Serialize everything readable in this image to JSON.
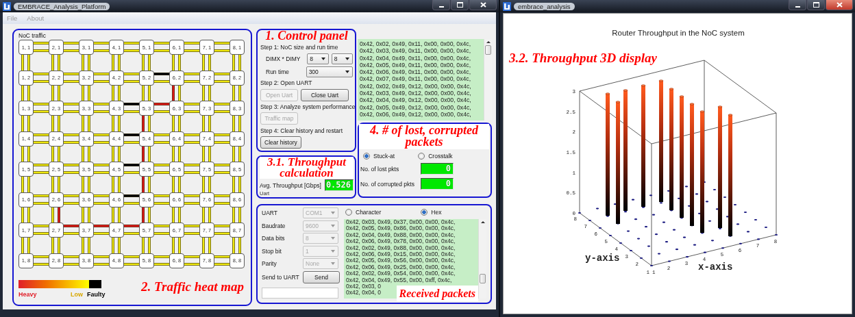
{
  "main_window": {
    "title": "EMBRACE_Analysis_Platform",
    "active": false,
    "menu": [
      "File",
      "About"
    ]
  },
  "heat_map": {
    "title": "NoC traffic",
    "annotation": "2. Traffic heat map",
    "routers": [
      [
        "1, 1",
        "2, 1",
        "3, 1",
        "4, 1",
        "5, 1",
        "6, 1",
        "7, 1",
        "8, 1"
      ],
      [
        "1, 2",
        "2, 2",
        "3, 2",
        "4, 2",
        "5, 2",
        "6, 2",
        "7, 2",
        "8, 2"
      ],
      [
        "1, 3",
        "2, 3",
        "3, 3",
        "4, 3",
        "5, 3",
        "6, 3",
        "7, 3",
        "8, 3"
      ],
      [
        "1, 4",
        "2, 4",
        "3, 4",
        "4, 4",
        "5, 4",
        "6, 4",
        "7, 4",
        "8, 4"
      ],
      [
        "1, 5",
        "2, 5",
        "3, 5",
        "4, 5",
        "5, 5",
        "6, 5",
        "7, 5",
        "8, 5"
      ],
      [
        "1, 6",
        "2, 6",
        "3, 6",
        "4, 6",
        "5, 6",
        "6, 6",
        "7, 6",
        "8, 6"
      ],
      [
        "1, 7",
        "2, 7",
        "3, 7",
        "4, 7",
        "5, 7",
        "6, 7",
        "7, 7",
        "8, 7"
      ],
      [
        "1, 8",
        "2, 8",
        "3, 8",
        "4, 8",
        "5, 8",
        "6, 8",
        "7, 8",
        "8, 8"
      ]
    ],
    "h_links": [
      [
        [
          {
            "color": "#f0ea10"
          },
          {
            "color": "#f0ea10"
          }
        ],
        [
          {
            "color": "#f0ea10"
          },
          {
            "color": "#f0ea10"
          }
        ],
        [
          {
            "color": "#f0ea10"
          },
          {
            "color": "#f0ea10"
          }
        ],
        [
          {
            "color": "#f0ea10"
          },
          {
            "color": "#f0ea10"
          }
        ],
        [
          {
            "color": "#f0ea10"
          },
          {
            "color": "#f0ea10"
          }
        ],
        [
          {
            "color": "#f0ea10"
          },
          {
            "color": "#f0ea10"
          }
        ],
        [
          {
            "color": "#f0ea10"
          },
          {
            "color": "#f0ea10"
          }
        ]
      ],
      [
        [
          {
            "color": "#f0ea10"
          },
          {
            "color": "#f0ea10"
          }
        ],
        [
          {
            "color": "#f0ea10"
          },
          {
            "color": "#f0ea10"
          }
        ],
        [
          {
            "color": "#f0ea10"
          },
          {
            "color": "#f0ea10"
          }
        ],
        [
          {
            "color": "#f0ea10"
          },
          {
            "color": "#f0ea10"
          }
        ],
        [
          {
            "color": "#000000"
          },
          {
            "color": "#f0ea10"
          }
        ],
        [
          {
            "color": "#f0ea10"
          },
          {
            "color": "#f0ea10"
          }
        ],
        [
          {
            "color": "#f0ea10"
          },
          {
            "color": "#f0ea10"
          }
        ]
      ],
      [
        [
          {
            "color": "#f0ea10"
          },
          {
            "color": "#f0ea10"
          }
        ],
        [
          {
            "color": "#f0ea10"
          },
          {
            "color": "#f0ea10"
          }
        ],
        [
          {
            "color": "#f0ea10"
          },
          {
            "color": "#f0ea10"
          }
        ],
        [
          {
            "color": "#000000"
          },
          {
            "color": "#f0ea10"
          }
        ],
        [
          {
            "color": "#e01818"
          },
          {
            "color": "#f0ea10"
          }
        ],
        [
          {
            "color": "#f0ea10"
          },
          {
            "color": "#f0ea10"
          }
        ],
        [
          {
            "color": "#f0ea10"
          },
          {
            "color": "#f0ea10"
          }
        ]
      ],
      [
        [
          {
            "color": "#f0ea10"
          },
          {
            "color": "#f0ea10"
          }
        ],
        [
          {
            "color": "#f0ea10"
          },
          {
            "color": "#f0ea10"
          }
        ],
        [
          {
            "color": "#f0ea10"
          },
          {
            "color": "#f0ea10"
          }
        ],
        [
          {
            "color": "#000000"
          },
          {
            "color": "#f0ea10"
          }
        ],
        [
          {
            "color": "#f0ea10"
          },
          {
            "color": "#f0ea10"
          }
        ],
        [
          {
            "color": "#f0ea10"
          },
          {
            "color": "#f0ea10"
          }
        ],
        [
          {
            "color": "#f0ea10"
          },
          {
            "color": "#f0ea10"
          }
        ]
      ],
      [
        [
          {
            "color": "#f0ea10"
          },
          {
            "color": "#f0ea10"
          }
        ],
        [
          {
            "color": "#f0ea10"
          },
          {
            "color": "#f0ea10"
          }
        ],
        [
          {
            "color": "#f0ea10"
          },
          {
            "color": "#f0ea10"
          }
        ],
        [
          {
            "color": "#000000"
          },
          {
            "color": "#f0ea10"
          }
        ],
        [
          {
            "color": "#f0ea10"
          },
          {
            "color": "#f0ea10"
          }
        ],
        [
          {
            "color": "#f0ea10"
          },
          {
            "color": "#f0ea10"
          }
        ],
        [
          {
            "color": "#f0ea10"
          },
          {
            "color": "#f0ea10"
          }
        ]
      ],
      [
        [
          {
            "color": "#f0ea10"
          },
          {
            "color": "#f0ea10"
          }
        ],
        [
          {
            "color": "#f0ea10"
          },
          {
            "color": "#f0ea10"
          }
        ],
        [
          {
            "color": "#f0ea10"
          },
          {
            "color": "#f0ea10"
          }
        ],
        [
          {
            "color": "#000000"
          },
          {
            "color": "#f0ea10"
          }
        ],
        [
          {
            "color": "#f0ea10"
          },
          {
            "color": "#f0ea10"
          }
        ],
        [
          {
            "color": "#f0ea10"
          },
          {
            "color": "#f0ea10"
          }
        ],
        [
          {
            "color": "#f0ea10"
          },
          {
            "color": "#f0ea10"
          }
        ]
      ],
      [
        [
          {
            "color": "#f0ea10"
          },
          {
            "color": "#f0ea10"
          }
        ],
        [
          {
            "color": "#e01818"
          },
          {
            "color": "#f0ea10"
          }
        ],
        [
          {
            "color": "#e01818"
          },
          {
            "color": "#f0ea10"
          }
        ],
        [
          {
            "color": "#e01818"
          },
          {
            "color": "#f0ea10"
          }
        ],
        [
          {
            "color": "#f0ea10"
          },
          {
            "color": "#f0ea10"
          }
        ],
        [
          {
            "color": "#f0ea10"
          },
          {
            "color": "#f0ea10"
          }
        ],
        [
          {
            "color": "#f0ea10"
          },
          {
            "color": "#f0ea10"
          }
        ]
      ],
      [
        [
          {
            "color": "#f0ea10"
          },
          {
            "color": "#f0ea10"
          }
        ],
        [
          {
            "color": "#f0ea10"
          },
          {
            "color": "#f0ea10"
          }
        ],
        [
          {
            "color": "#f0ea10"
          },
          {
            "color": "#f0ea10"
          }
        ],
        [
          {
            "color": "#f0ea10"
          },
          {
            "color": "#f0ea10"
          }
        ],
        [
          {
            "color": "#f0ea10"
          },
          {
            "color": "#f0ea10"
          }
        ],
        [
          {
            "color": "#f0ea10"
          },
          {
            "color": "#f0ea10"
          }
        ],
        [
          {
            "color": "#f0ea10"
          },
          {
            "color": "#f0ea10"
          }
        ]
      ]
    ],
    "v_links": [
      [
        [
          {
            "color": "#f0ea10"
          },
          {
            "color": "#f0ea10"
          }
        ],
        [
          {
            "color": "#f0ea10"
          },
          {
            "color": "#f0ea10"
          }
        ],
        [
          {
            "color": "#f0ea10"
          },
          {
            "color": "#f0ea10"
          }
        ],
        [
          {
            "color": "#f0ea10"
          },
          {
            "color": "#f0ea10"
          }
        ],
        [
          {
            "color": "#f0ea10"
          },
          {
            "color": "#f0ea10"
          }
        ],
        [
          {
            "color": "#f0ea10"
          },
          {
            "color": "#f0ea10"
          }
        ],
        [
          {
            "color": "#f0ea10"
          },
          {
            "color": "#f0ea10"
          }
        ],
        [
          {
            "color": "#f0ea10"
          },
          {
            "color": "#f0ea10"
          }
        ]
      ],
      [
        [
          {
            "color": "#f0ea10"
          },
          {
            "color": "#f0ea10"
          }
        ],
        [
          {
            "color": "#f0ea10"
          },
          {
            "color": "#f0ea10"
          }
        ],
        [
          {
            "color": "#f0ea10"
          },
          {
            "color": "#f0ea10"
          }
        ],
        [
          {
            "color": "#f0ea10"
          },
          {
            "color": "#f0ea10"
          }
        ],
        [
          {
            "color": "#f0ea10"
          },
          {
            "color": "#f0ea10"
          }
        ],
        [
          {
            "color": "#e01818"
          },
          {
            "color": "#f0ea10"
          }
        ],
        [
          {
            "color": "#f0ea10"
          },
          {
            "color": "#f0ea10"
          }
        ],
        [
          {
            "color": "#f0ea10"
          },
          {
            "color": "#f0ea10"
          }
        ]
      ],
      [
        [
          {
            "color": "#f0ea10"
          },
          {
            "color": "#f0ea10"
          }
        ],
        [
          {
            "color": "#f0ea10"
          },
          {
            "color": "#f0ea10"
          }
        ],
        [
          {
            "color": "#f0ea10"
          },
          {
            "color": "#f0ea10"
          }
        ],
        [
          {
            "color": "#f0ea10"
          },
          {
            "color": "#f0ea10"
          }
        ],
        [
          {
            "color": "#e01818"
          },
          {
            "color": "#f0ea10"
          }
        ],
        [
          {
            "color": "#f0ea10"
          },
          {
            "color": "#f0ea10"
          }
        ],
        [
          {
            "color": "#f0ea10"
          },
          {
            "color": "#f0ea10"
          }
        ],
        [
          {
            "color": "#f0ea10"
          },
          {
            "color": "#f0ea10"
          }
        ]
      ],
      [
        [
          {
            "color": "#f0ea10"
          },
          {
            "color": "#f0ea10"
          }
        ],
        [
          {
            "color": "#f0ea10"
          },
          {
            "color": "#f0ea10"
          }
        ],
        [
          {
            "color": "#f0ea10"
          },
          {
            "color": "#f0ea10"
          }
        ],
        [
          {
            "color": "#f0ea10"
          },
          {
            "color": "#f0ea10"
          }
        ],
        [
          {
            "color": "#e01818"
          },
          {
            "color": "#f0ea10"
          }
        ],
        [
          {
            "color": "#f0ea10"
          },
          {
            "color": "#f0ea10"
          }
        ],
        [
          {
            "color": "#f0ea10"
          },
          {
            "color": "#f0ea10"
          }
        ],
        [
          {
            "color": "#f0ea10"
          },
          {
            "color": "#f0ea10"
          }
        ]
      ],
      [
        [
          {
            "color": "#f0ea10"
          },
          {
            "color": "#f0ea10"
          }
        ],
        [
          {
            "color": "#f0ea10"
          },
          {
            "color": "#f0ea10"
          }
        ],
        [
          {
            "color": "#f0ea10"
          },
          {
            "color": "#f0ea10"
          }
        ],
        [
          {
            "color": "#f0ea10"
          },
          {
            "color": "#f0ea10"
          }
        ],
        [
          {
            "color": "#e01818"
          },
          {
            "color": "#f0ea10"
          }
        ],
        [
          {
            "color": "#f0ea10"
          },
          {
            "color": "#f0ea10"
          }
        ],
        [
          {
            "color": "#f0ea10"
          },
          {
            "color": "#f0ea10"
          }
        ],
        [
          {
            "color": "#f0ea10"
          },
          {
            "color": "#f0ea10"
          }
        ]
      ],
      [
        [
          {
            "color": "#f0ea10"
          },
          {
            "color": "#f0ea10"
          }
        ],
        [
          {
            "color": "#f0ea10"
          },
          {
            "color": "#e01818"
          }
        ],
        [
          {
            "color": "#f0ea10"
          },
          {
            "color": "#f0ea10"
          }
        ],
        [
          {
            "color": "#f0ea10"
          },
          {
            "color": "#f0ea10"
          }
        ],
        [
          {
            "color": "#e01818"
          },
          {
            "color": "#f0ea10"
          }
        ],
        [
          {
            "color": "#f0ea10"
          },
          {
            "color": "#f0ea10"
          }
        ],
        [
          {
            "color": "#f0ea10"
          },
          {
            "color": "#f0ea10"
          }
        ],
        [
          {
            "color": "#f0ea10"
          },
          {
            "color": "#f0ea10"
          }
        ]
      ],
      [
        [
          {
            "color": "#f0ea10"
          },
          {
            "color": "#f0ea10"
          }
        ],
        [
          {
            "color": "#f0ea10"
          },
          {
            "color": "#f0ea10"
          }
        ],
        [
          {
            "color": "#f0ea10"
          },
          {
            "color": "#f0ea10"
          }
        ],
        [
          {
            "color": "#f0ea10"
          },
          {
            "color": "#f0ea10"
          }
        ],
        [
          {
            "color": "#f0ea10"
          },
          {
            "color": "#f0ea10"
          }
        ],
        [
          {
            "color": "#f0ea10"
          },
          {
            "color": "#f0ea10"
          }
        ],
        [
          {
            "color": "#f0ea10"
          },
          {
            "color": "#f0ea10"
          }
        ],
        [
          {
            "color": "#f0ea10"
          },
          {
            "color": "#f0ea10"
          }
        ]
      ]
    ],
    "legend": [
      {
        "label": "Heavy",
        "color": "#e0202a"
      },
      {
        "label": "Low",
        "color": "#d8a800"
      },
      {
        "label": "Faulty",
        "color": "#000000"
      }
    ]
  },
  "control_panel": {
    "annotation": "1. Control panel",
    "step1": "Step 1: NoC size and run time",
    "dim_label": "DIMX * DIMY",
    "dimx": "8",
    "dimy": "8",
    "run_label": "Run time",
    "run_time": "300",
    "step2": "Step 2: Open UART",
    "open_button": {
      "label": "Open Uart",
      "disabled": true
    },
    "close_button": {
      "label": "Close Uart",
      "disabled": false
    },
    "step3": "Step 3: Analyze system performance",
    "traffic_button": {
      "label": "Traffic map",
      "disabled": true
    },
    "step4": "Step 4: Clear history and restart",
    "clear_button": {
      "label": "Clear history",
      "disabled": false
    }
  },
  "log": {
    "lines": [
      "0x42, 0x02, 0x49, 0x11, 0x00, 0x00, 0x4c,",
      "0x42, 0x03, 0x49, 0x11, 0x00, 0x00, 0x4c,",
      "0x42, 0x04, 0x49, 0x11, 0x00, 0x00, 0x4c,",
      "0x42, 0x05, 0x49, 0x11, 0x00, 0x00, 0x4c,",
      "0x42, 0x06, 0x49, 0x11, 0x00, 0x00, 0x4c,",
      "0x42, 0x07, 0x49, 0x11, 0x00, 0x00, 0x4c,",
      "0x42, 0x02, 0x49, 0x12, 0x00, 0x00, 0x4c,",
      "0x42, 0x03, 0x49, 0x12, 0x00, 0x00, 0x4c,",
      "0x42, 0x04, 0x49, 0x12, 0x00, 0x00, 0x4c,",
      "0x42, 0x05, 0x49, 0x12, 0x00, 0x00, 0x4c,",
      "0x42, 0x06, 0x49, 0x12, 0x00, 0x00, 0x4c,"
    ]
  },
  "throughput": {
    "annotation": "3.1. Throughput calculation",
    "label": "Avg. Throughput [Gbps]",
    "value": "0.526",
    "caption": "Uart"
  },
  "faults": {
    "annotation": "4. # of lost, corrupted packets",
    "modes": [
      {
        "label": "Stuck-at",
        "selected": true
      },
      {
        "label": "Crosstalk",
        "selected": false
      }
    ],
    "counters": [
      {
        "label": "No. of lost pkts",
        "value": "0"
      },
      {
        "label": "No. of corrupted pkts",
        "value": "0"
      }
    ]
  },
  "uart": {
    "annotation": "Received packets",
    "settings": [
      {
        "label": "UART",
        "value": "COM1",
        "disabled": true
      },
      {
        "label": "Baudrate",
        "value": "9600",
        "disabled": true
      },
      {
        "label": "Data bits",
        "value": "8",
        "disabled": true
      },
      {
        "label": "Stop bit",
        "value": "1",
        "disabled": true
      },
      {
        "label": "Parity",
        "value": "None",
        "disabled": true
      }
    ],
    "send_label": "Send to UART",
    "send_button": "Send",
    "formats": [
      {
        "label": "Character",
        "selected": false
      },
      {
        "label": "Hex",
        "selected": true
      }
    ],
    "lines": [
      "0x42, 0x03, 0x49, 0x37, 0x00, 0x00, 0x4c,",
      "0x42, 0x05, 0x49, 0x86, 0x00, 0x00, 0x4c,",
      "0x42, 0x04, 0x49, 0x88, 0x00, 0x00, 0x4c,",
      "0x42, 0x06, 0x49, 0x78, 0x00, 0x00, 0x4c,",
      "0x42, 0x02, 0x49, 0x88, 0x00, 0x00, 0x4c,",
      "0x42, 0x06, 0x49, 0x15, 0x00, 0x00, 0x4c,",
      "0x42, 0x05, 0x49, 0x56, 0x00, 0x00, 0x4c,",
      "0x42, 0x06, 0x49, 0x25, 0x00, 0x00, 0x4c,",
      "0x42, 0x02, 0x49, 0x54, 0x00, 0x00, 0x4c,",
      "0x42, 0x04, 0x49, 0x55, 0x00, 0xff, 0x4c,",
      "0x42, 0x03, 0",
      "0x42, 0x04, 0"
    ]
  },
  "plot_window": {
    "title": "embrace_analysis",
    "active": true,
    "chart_title": "Router Throughput in the NoC system",
    "annotation": "3.2. Throughput 3D display",
    "z_ticks": [
      "3",
      "2.5",
      "2",
      "1.5",
      "1",
      "0.5",
      "0"
    ],
    "x_ticks": [
      "1",
      "2",
      "3",
      "4",
      "5",
      "6",
      "7",
      "8"
    ],
    "y_ticks": [
      "1",
      "2",
      "3",
      "4",
      "5",
      "6",
      "7",
      "8"
    ],
    "xlabel": "x-axis",
    "ylabel": "y-axis"
  }
}
